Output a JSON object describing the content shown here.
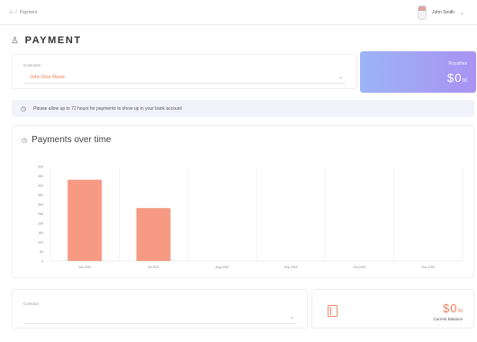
{
  "breadcrumb": {
    "current": "Payment"
  },
  "user": {
    "name": "John Smith"
  },
  "page": {
    "title": "PAYMENT"
  },
  "customer": {
    "label": "Customer",
    "value": "John Doe Music"
  },
  "royalties": {
    "label": "Royalties",
    "currency": "$",
    "whole": "0",
    "cents": "00"
  },
  "notice": {
    "text": "Please allow up to 72 hours for payments to show up in your bank account"
  },
  "chart": {
    "title": "Payments over time"
  },
  "chart_data": {
    "type": "bar",
    "title": "Payments over time",
    "categories": [
      "Jun 2022",
      "Jul 2022",
      "Aug 2022",
      "Sep 2022",
      "Oct 2022",
      "Nov 2022"
    ],
    "values": [
      430,
      280,
      0,
      0,
      0,
      0
    ],
    "y_ticks": [
      0,
      50,
      100,
      150,
      200,
      250,
      300,
      350,
      400,
      450,
      500
    ],
    "ylim": [
      0,
      500
    ],
    "grid": true,
    "color": "#f79a83"
  },
  "contract": {
    "label": "Contract",
    "value": ""
  },
  "balance": {
    "currency": "$",
    "whole": "0",
    "cents": "00",
    "label": "Current Balance"
  },
  "colors": {
    "accent": "#f07e5e",
    "bar": "#f79a83",
    "royalties_from": "#9cb4f7",
    "royalties_to": "#a992f3"
  }
}
